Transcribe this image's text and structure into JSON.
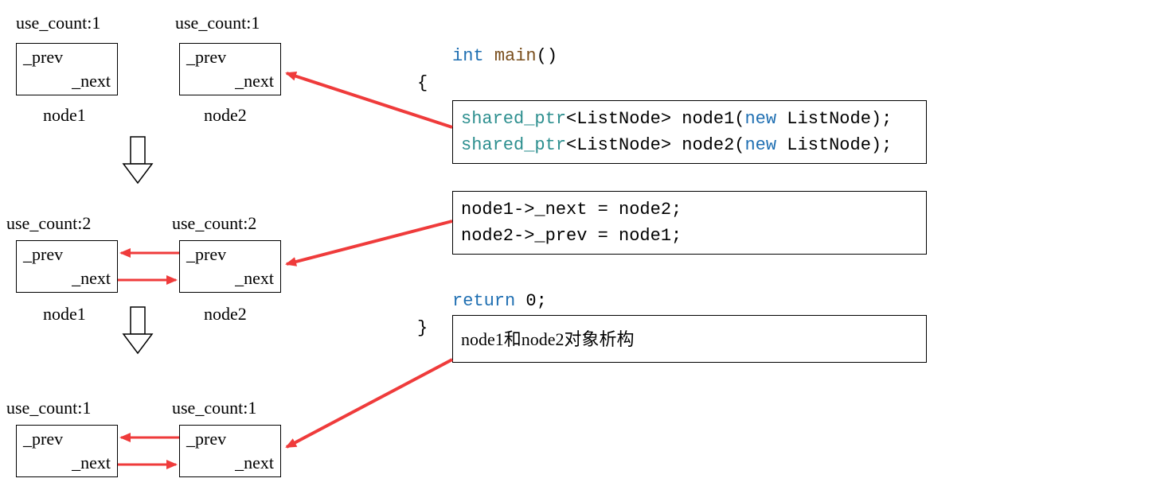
{
  "stage1": {
    "node1": {
      "count": "use_count:1",
      "prev": "_prev",
      "next": "_next",
      "name": "node1"
    },
    "node2": {
      "count": "use_count:1",
      "prev": "_prev",
      "next": "_next",
      "name": "node2"
    }
  },
  "stage2": {
    "node1": {
      "count": "use_count:2",
      "prev": "_prev",
      "next": "_next",
      "name": "node1"
    },
    "node2": {
      "count": "use_count:2",
      "prev": "_prev",
      "next": "_next",
      "name": "node2"
    }
  },
  "stage3": {
    "node1": {
      "count": "use_count:1",
      "prev": "_prev",
      "next": "_next"
    },
    "node2": {
      "count": "use_count:1",
      "prev": "_prev",
      "next": "_next"
    }
  },
  "code": {
    "sig_int": "int",
    "sig_main": "main",
    "sig_paren": "()",
    "brace_open": "{",
    "brace_close": "}",
    "line1_a": "shared_ptr",
    "line1_b": "<ListNode>",
    "line1_c": " node1(",
    "line1_d": "new",
    "line1_e": " ListNode);",
    "line2_a": "shared_ptr",
    "line2_b": "<ListNode>",
    "line2_c": " node2(",
    "line2_d": "new",
    "line2_e": " ListNode);",
    "line3": "node1->_next = node2;",
    "line4": "node2->_prev = node1;",
    "ret_a": "return",
    "ret_b": " 0;",
    "destruct": "node1和node2对象析构"
  }
}
